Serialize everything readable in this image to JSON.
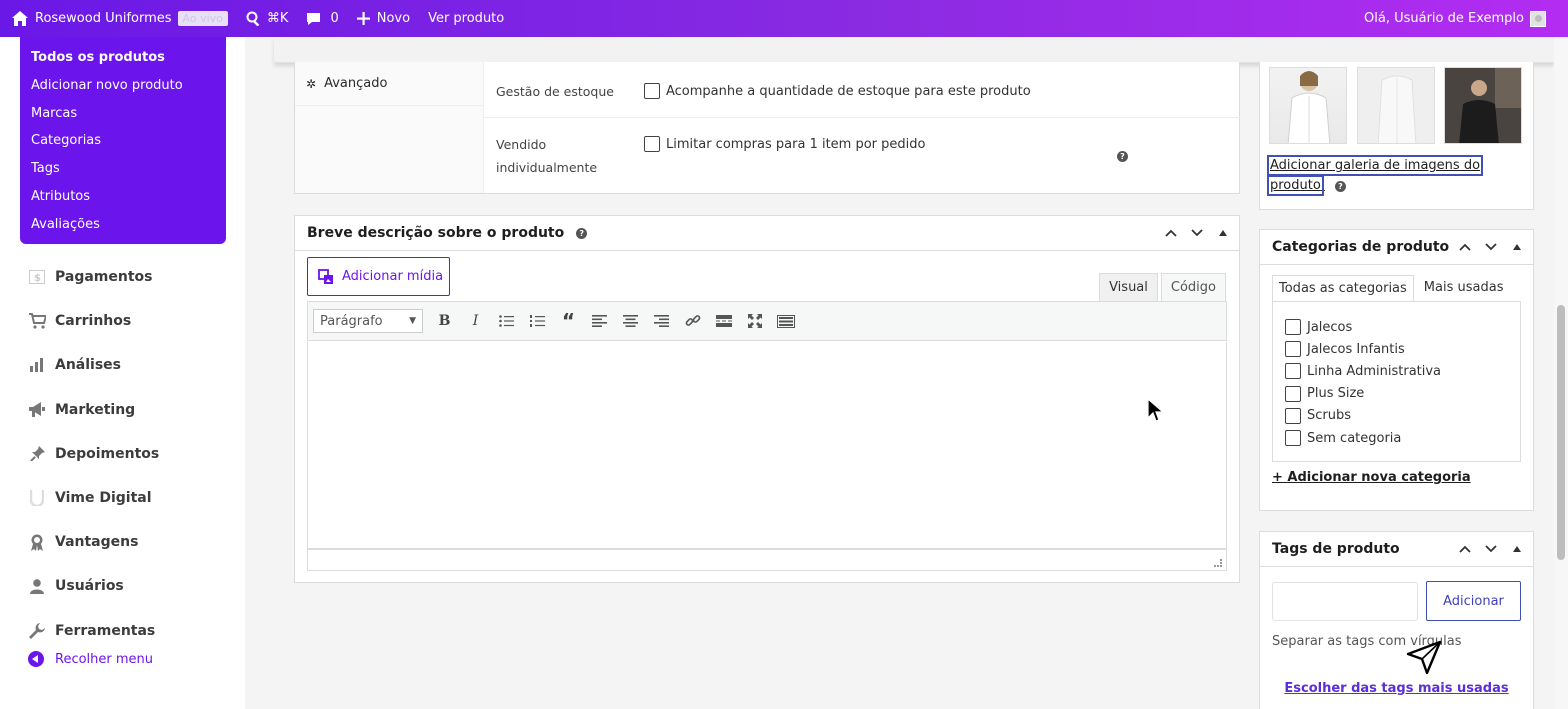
{
  "adminbar": {
    "site_name": "Rosewood Uniformes",
    "live_badge": "Ao vivo",
    "search_shortcut": "⌘K",
    "comments_count": "0",
    "new_label": "Novo",
    "view_product": "Ver produto",
    "greeting": "Olá, Usuário de Exemplo"
  },
  "sidebar": {
    "submenu": [
      "Todos os produtos",
      "Adicionar novo produto",
      "Marcas",
      "Categorias",
      "Tags",
      "Atributos",
      "Avaliações"
    ],
    "menu": [
      {
        "label": "Pagamentos",
        "icon": "payments-icon"
      },
      {
        "label": "Carrinhos",
        "icon": "cart-icon"
      },
      {
        "label": "Análises",
        "icon": "analytics-icon"
      },
      {
        "label": "Marketing",
        "icon": "megaphone-icon"
      },
      {
        "label": "Depoimentos",
        "icon": "pin-icon"
      },
      {
        "label": "Vime Digital",
        "icon": "vime-logo-icon"
      },
      {
        "label": "Vantagens",
        "icon": "award-icon"
      },
      {
        "label": "Usuários",
        "icon": "user-icon"
      },
      {
        "label": "Ferramentas",
        "icon": "wrench-icon"
      }
    ],
    "collapse_label": "Recolher menu"
  },
  "product_data": {
    "tab_advanced": "Avançado",
    "stock_label": "Gestão de estoque",
    "stock_checkbox": "Acompanhe a quantidade de estoque para este produto",
    "sold_label_1": "Vendido",
    "sold_label_2": "individualmente",
    "sold_checkbox": "Limitar compras para 1 item por pedido"
  },
  "short_description": {
    "title": "Breve descrição sobre o produto",
    "add_media": "Adicionar mídia",
    "tab_visual": "Visual",
    "tab_code": "Código",
    "format_select": "Parágrafo"
  },
  "gallery": {
    "link_line1": "Adicionar galeria de imagens do",
    "link_line2": "produto"
  },
  "categories": {
    "title": "Categorias de produto",
    "tab_all": "Todas as categorias",
    "tab_most_used": "Mais usadas",
    "items": [
      "Jalecos",
      "Jalecos Infantis",
      "Linha Administrativa",
      "Plus Size",
      "Scrubs",
      "Sem categoria"
    ],
    "add_new": "+ Adicionar nova categoria"
  },
  "tags": {
    "title": "Tags de produto",
    "add_button": "Adicionar",
    "hint": "Separar as tags com vírgulas",
    "most_used_link": "Escolher das tags mais usadas"
  },
  "colors": {
    "brand_purple": "#6b14ec",
    "adminbar_gradient_end": "#b32cf2"
  }
}
